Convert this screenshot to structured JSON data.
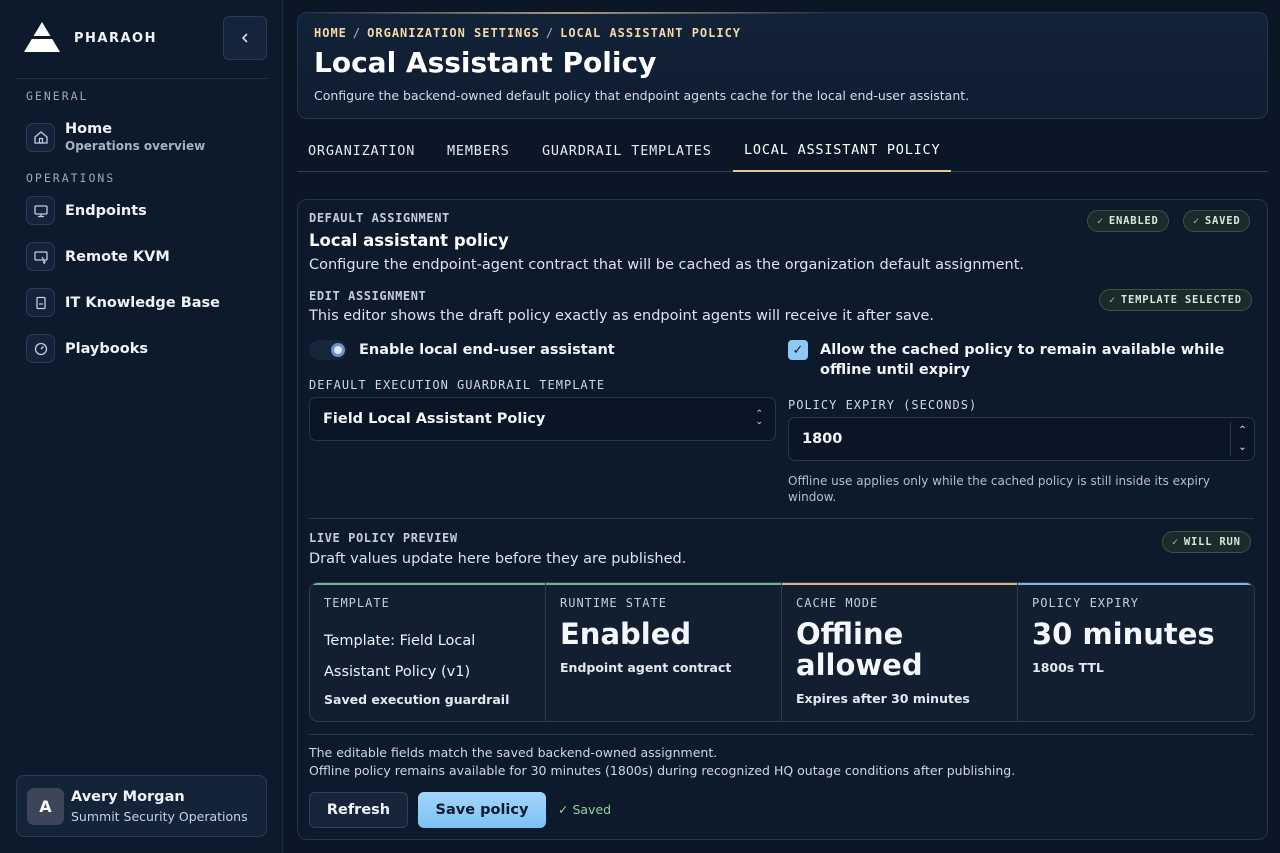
{
  "app": {
    "brand": "PHARAOH"
  },
  "sidebar": {
    "sections": [
      {
        "label": "GENERAL"
      },
      {
        "label": "OPERATIONS"
      }
    ],
    "items": [
      {
        "label": "Home",
        "sublabel": "Operations overview",
        "icon": "home-icon"
      },
      {
        "label": "Endpoints",
        "icon": "monitor-icon"
      },
      {
        "label": "Remote KVM",
        "icon": "remote-screen-icon"
      },
      {
        "label": "IT Knowledge Base",
        "icon": "book-icon"
      },
      {
        "label": "Playbooks",
        "icon": "gauge-icon"
      }
    ],
    "user": {
      "initial": "A",
      "name": "Avery Morgan",
      "org": "Summit Security Operations"
    }
  },
  "header": {
    "breadcrumb": [
      "HOME",
      "ORGANIZATION SETTINGS",
      "LOCAL ASSISTANT POLICY"
    ],
    "breadcrumb_sep": "/",
    "title": "Local Assistant Policy",
    "description": "Configure the backend-owned default policy that endpoint agents cache for the local end-user assistant."
  },
  "tabs": [
    {
      "label": "ORGANIZATION",
      "active": false
    },
    {
      "label": "MEMBERS",
      "active": false
    },
    {
      "label": "GUARDRAIL TEMPLATES",
      "active": false
    },
    {
      "label": "LOCAL ASSISTANT POLICY",
      "active": true
    }
  ],
  "assignment": {
    "eyebrow": "DEFAULT ASSIGNMENT",
    "title": "Local assistant policy",
    "description": "Configure the endpoint-agent contract that will be cached as the organization default assignment.",
    "badges": [
      "ENABLED",
      "SAVED"
    ]
  },
  "edit": {
    "eyebrow": "EDIT ASSIGNMENT",
    "description": "This editor shows the draft policy exactly as endpoint agents will receive it after save.",
    "badge": "TEMPLATE SELECTED",
    "enable_label": "Enable local end-user assistant",
    "enable_on": true,
    "offline_label": "Allow the cached policy to remain available while offline until expiry",
    "offline_checked": true,
    "template_label": "DEFAULT EXECUTION GUARDRAIL TEMPLATE",
    "template_value": "Field Local Assistant Policy",
    "expiry_label": "POLICY EXPIRY (SECONDS)",
    "expiry_value": "1800",
    "expiry_help": "Offline use applies only while the cached policy is still inside its expiry window."
  },
  "preview": {
    "eyebrow": "LIVE POLICY PREVIEW",
    "description": "Draft values update here before they are published.",
    "badge": "WILL RUN",
    "cells": [
      {
        "label": "TEMPLATE",
        "value": "Template: Field Local Assistant Policy (v1)",
        "sub": "Saved execution guardrail",
        "accent": "#6fb886"
      },
      {
        "label": "RUNTIME STATE",
        "value": "Enabled",
        "sub": "Endpoint agent contract",
        "accent": "#6fb886"
      },
      {
        "label": "CACHE MODE",
        "value": "Offline allowed",
        "sub": "Expires after 30 minutes",
        "accent": "#d8b77f"
      },
      {
        "label": "POLICY EXPIRY",
        "value": "30 minutes",
        "sub": "1800s TTL",
        "accent": "#7db3e6"
      }
    ]
  },
  "footer": {
    "note1": "The editable fields match the saved backend-owned assignment.",
    "note2": "Offline policy remains available for 30 minutes (1800s) during recognized HQ outage conditions after publishing.",
    "refresh_label": "Refresh",
    "save_label": "Save policy",
    "saved_status": "Saved"
  }
}
